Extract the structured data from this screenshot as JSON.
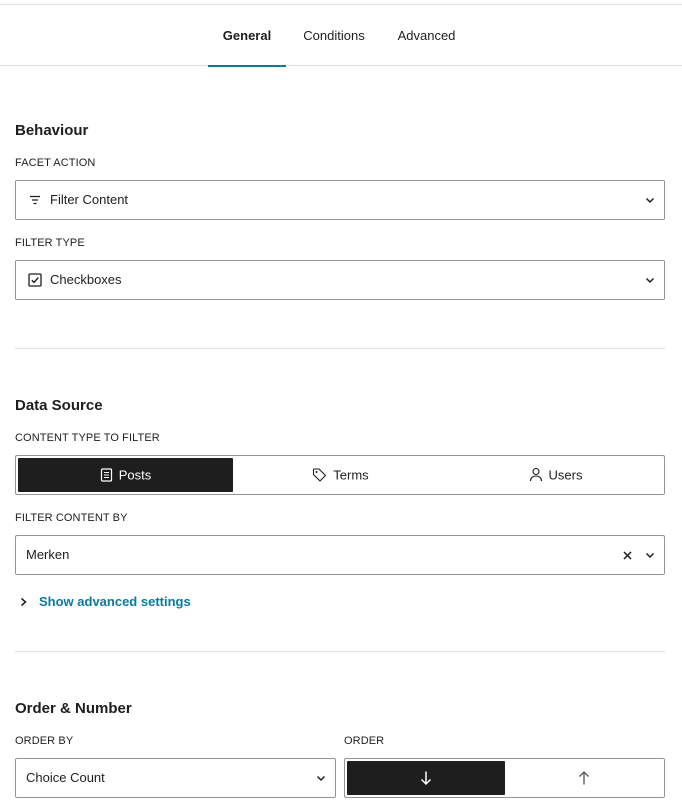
{
  "tabs": [
    {
      "label": "General",
      "active": true
    },
    {
      "label": "Conditions",
      "active": false
    },
    {
      "label": "Advanced",
      "active": false
    }
  ],
  "behaviour": {
    "title": "Behaviour",
    "facet_action": {
      "label": "FACET ACTION",
      "value": "Filter Content",
      "icon": "filter-lines-icon"
    },
    "filter_type": {
      "label": "FILTER TYPE",
      "value": "Checkboxes",
      "icon": "checkbox-checked-icon"
    }
  },
  "data_source": {
    "title": "Data Source",
    "content_type": {
      "label": "CONTENT TYPE TO FILTER",
      "options": [
        {
          "label": "Posts",
          "icon": "document-icon",
          "selected": true
        },
        {
          "label": "Terms",
          "icon": "tag-icon",
          "selected": false
        },
        {
          "label": "Users",
          "icon": "user-icon",
          "selected": false
        }
      ]
    },
    "filter_content_by": {
      "label": "FILTER CONTENT BY",
      "value": "Merken"
    },
    "advanced_link": "Show advanced settings"
  },
  "order_number": {
    "title": "Order & Number",
    "order_by": {
      "label": "ORDER BY",
      "value": "Choice Count"
    },
    "order": {
      "label": "ORDER",
      "options": [
        {
          "icon": "arrow-down-icon",
          "direction": "descending",
          "selected": true
        },
        {
          "icon": "arrow-up-icon",
          "direction": "ascending",
          "selected": false
        }
      ]
    }
  },
  "colors": {
    "accent": "#0a7aa0",
    "dark": "#1e1e1e",
    "border": "#949494",
    "divider": "#e0e0e0"
  }
}
